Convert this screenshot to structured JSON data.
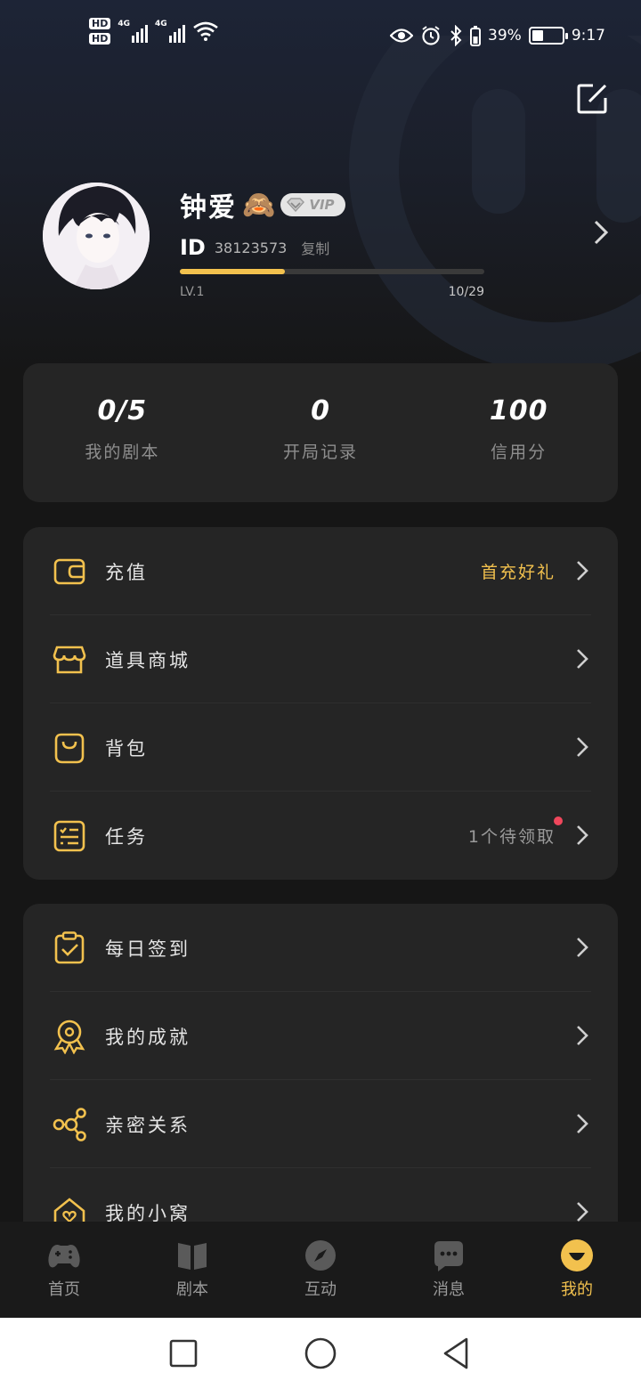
{
  "status_bar": {
    "hd1": "HD",
    "hd2": "HD",
    "network1": "4G",
    "network2": "4G",
    "battery_percent": "39%",
    "battery_level": 0.39,
    "time": "9:17"
  },
  "profile": {
    "name": "钟爱",
    "emoji": "🙈",
    "vip_label": "VIP",
    "id_label": "ID",
    "id_value": "38123573",
    "copy_label": "复制",
    "level": "LV.1",
    "xp_text": "10/29",
    "xp_progress": 0.345
  },
  "stats": [
    {
      "value": "0/5",
      "label": "我的剧本"
    },
    {
      "value": "0",
      "label": "开局记录"
    },
    {
      "value": "100",
      "label": "信用分"
    }
  ],
  "menu_group_1": [
    {
      "label": "充值",
      "right_text": "首充好礼"
    },
    {
      "label": "道具商城",
      "right_text": ""
    },
    {
      "label": "背包",
      "right_text": ""
    },
    {
      "label": "任务",
      "right_text": "1个待领取"
    }
  ],
  "menu_group_2": [
    {
      "label": "每日签到"
    },
    {
      "label": "我的成就"
    },
    {
      "label": "亲密关系"
    },
    {
      "label": "我的小窝"
    }
  ],
  "tabs": [
    {
      "label": "首页",
      "icon": "gamepad-icon"
    },
    {
      "label": "剧本",
      "icon": "book-icon"
    },
    {
      "label": "互动",
      "icon": "compass-icon"
    },
    {
      "label": "消息",
      "icon": "chat-bubble-icon"
    },
    {
      "label": "我的",
      "icon": "smiley-icon"
    }
  ],
  "active_tab": "我的",
  "colors": {
    "accent": "#f2c14e",
    "background": "#161616",
    "card": "#252525",
    "notification_dot": "#f0475c"
  }
}
